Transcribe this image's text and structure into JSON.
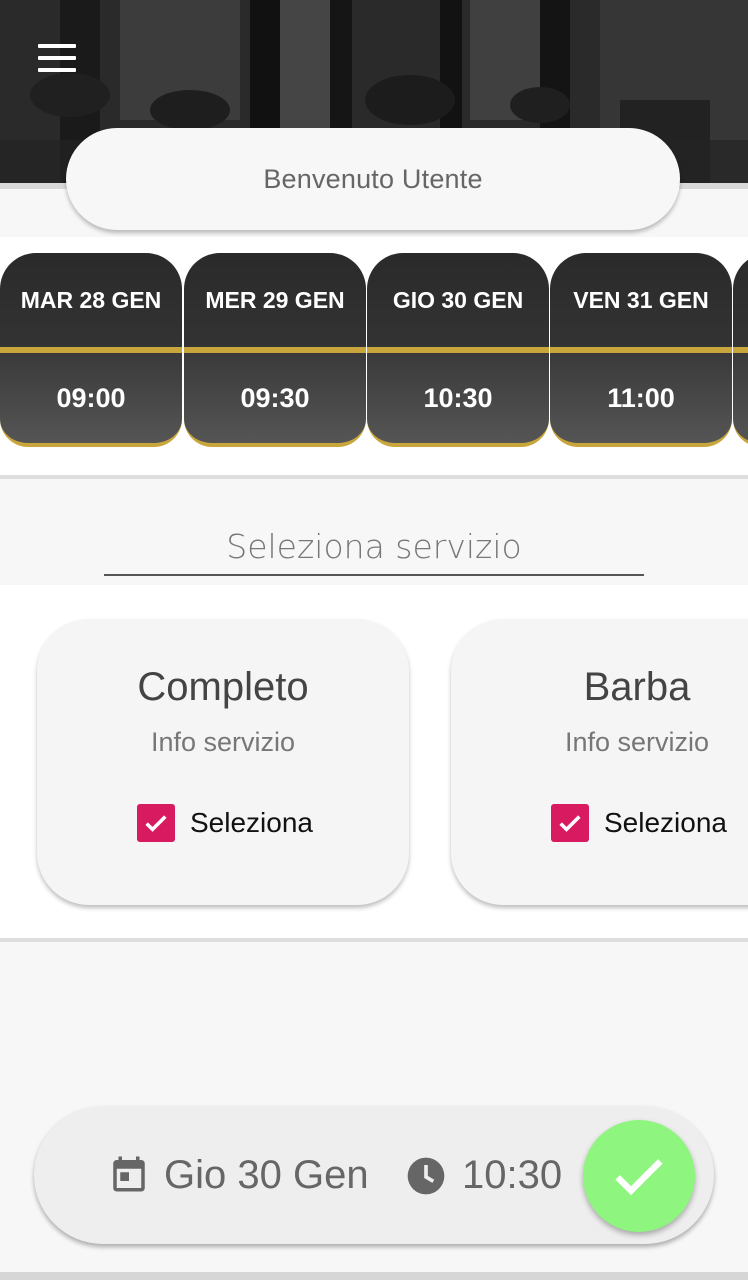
{
  "header": {
    "welcome_text": "Benvenuto Utente"
  },
  "slots": [
    {
      "day": "MAR 28 GEN",
      "time": "09:00"
    },
    {
      "day": "MER 29 GEN",
      "time": "09:30"
    },
    {
      "day": "GIO 30 GEN",
      "time": "10:30"
    },
    {
      "day": "VEN 31 GEN",
      "time": "11:00"
    }
  ],
  "services": {
    "title": "Seleziona servizio",
    "cards": [
      {
        "name": "Completo",
        "info": "Info servizio",
        "select_label": "Seleziona",
        "checked": true
      },
      {
        "name": "Barba",
        "info": "Info servizio",
        "select_label": "Seleziona",
        "checked": true
      }
    ]
  },
  "summary": {
    "date": "Gio 30 Gen",
    "time": "10:30",
    "calendar_icon": "calendar-icon",
    "clock_icon": "clock-icon",
    "confirm_icon": "check-icon"
  },
  "colors": {
    "gold": "#c9a63b",
    "checkbox": "#d81b60",
    "confirm": "#8ef57e",
    "slot_dark": "#2a2a2a"
  }
}
